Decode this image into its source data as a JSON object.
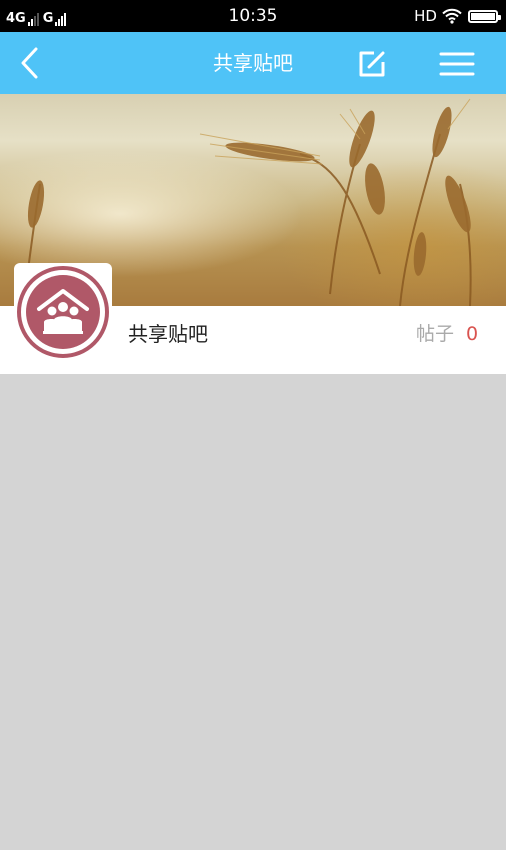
{
  "status_bar": {
    "network_1": "4G",
    "network_2": "G",
    "time": "10:35",
    "hd": "HD"
  },
  "nav": {
    "title": "共享贴吧",
    "back_icon": "chevron-left-icon",
    "edit_icon": "edit-icon",
    "menu_icon": "hamburger-menu-icon"
  },
  "forum": {
    "name": "共享贴吧",
    "post_label": "帖子",
    "post_count": "0",
    "avatar_icon": "community-house-icon"
  },
  "colors": {
    "nav_bar": "#4fc3f7",
    "avatar_accent": "#b05868",
    "count_red": "#d9534f",
    "page_bg": "#d4d4d4"
  }
}
